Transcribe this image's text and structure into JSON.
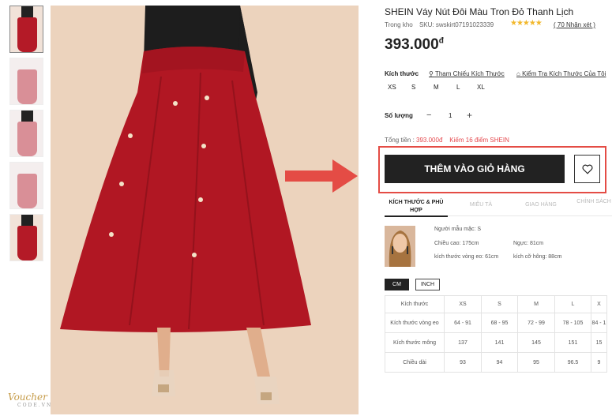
{
  "product": {
    "title": "SHEIN Váy Nút Đôi Màu Tron Đỏ Thanh Lịch",
    "stock": "Trong kho",
    "sku": "SKU: swskirt07191023339",
    "stars": "★★★★★",
    "rating": 4.5,
    "reviews": "( 70 Nhận xét )",
    "price": "393.000",
    "currency": "đ"
  },
  "size": {
    "label": "Kích thước",
    "reference_link": "Tham Chiếu Kích Thước",
    "check_link": "Kiểm Tra Kích Thước Của Tôi",
    "options": [
      "XS",
      "S",
      "M",
      "L",
      "XL"
    ]
  },
  "quantity": {
    "label": "Số lượng",
    "minus": "−",
    "value": "1",
    "plus": "+"
  },
  "total": {
    "label": "Tổng tiền : ",
    "amount": "393.000đ",
    "points": "Kiếm  16  điểm SHEIN"
  },
  "actions": {
    "add_to_cart": "THÊM VÀO GIỎ HÀNG",
    "accent": "#e44c45"
  },
  "tabs": [
    "KÍCH THƯỚC & PHÙ HỢP",
    "MIÊU TẢ",
    "GIAO HÀNG",
    "CHÍNH SÁCH TRẢ"
  ],
  "model": {
    "size": "Người mẫu mặc: S",
    "height": "Chiều cao: 175cm",
    "bust": "Ngực: 81cm",
    "waist": "kích thước vòng eo: 61cm",
    "hip": "kích cỡ hông: 88cm"
  },
  "units": {
    "cm": "CM",
    "inch": "INCH"
  },
  "size_table": {
    "headers": [
      "Kích thước",
      "XS",
      "S",
      "M",
      "L",
      "X"
    ],
    "rows": [
      [
        "Kích thước vòng eo",
        "64 - 91",
        "68 - 95",
        "72 - 99",
        "78 - 105",
        "84 - 1"
      ],
      [
        "Kích thước mông",
        "137",
        "141",
        "145",
        "151",
        "15"
      ],
      [
        "Chiều dài",
        "93",
        "94",
        "95",
        "96.5",
        "9"
      ]
    ]
  },
  "watermark": {
    "main": "Voucher",
    "sub": "CODE.VN"
  }
}
